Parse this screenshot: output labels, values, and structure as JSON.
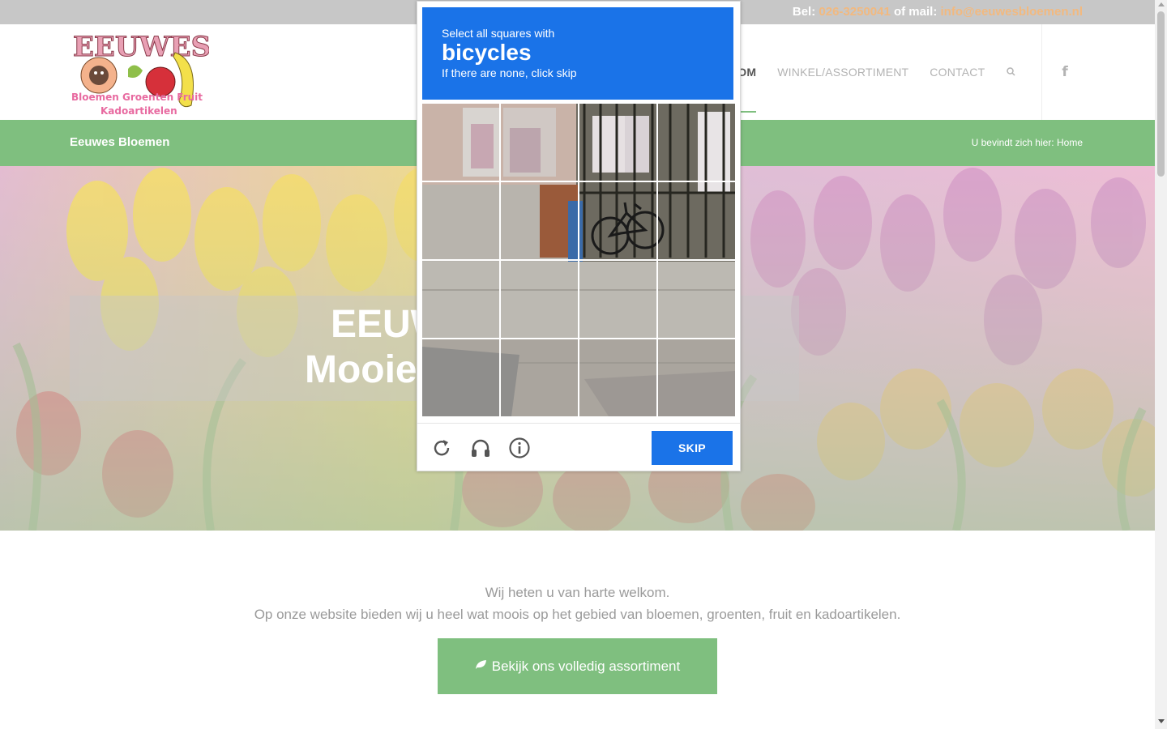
{
  "topbar": {
    "phone_label": "Bel:",
    "phone": "026-3250041",
    "mail_label": "of mail:",
    "email": "info@eeuwesbloemen.nl"
  },
  "header": {
    "logo_text": "EEUWES",
    "logo_tagline": "Bloemen Groenten Fruit",
    "logo_tagline2": "Kadoartikelen",
    "nav": {
      "active_partial": "KOM",
      "shop": "WINKEL/ASSORTIMENT",
      "contact": "CONTACT"
    },
    "facebook_glyph": "f"
  },
  "titlebar": {
    "site_name": "Eeuwes Bloemen",
    "breadcrumb_label": "U bevindt zich hier:",
    "breadcrumb_home": "Home"
  },
  "hero": {
    "line1": "EEUWES B",
    "line2": "Mooie bloeme"
  },
  "welcome": {
    "line1": "Wij heten u van harte welkom.",
    "line2": "Op onze website bieden wij u heel wat moois op het gebied van bloemen, groenten, fruit en kadoartikelen."
  },
  "cta": {
    "label": "Bekijk ons volledig assortiment"
  },
  "captcha": {
    "instruction": "Select all squares with",
    "target": "bicycles",
    "hint": "If there are none, click skip",
    "skip_label": "SKIP",
    "tiles": [
      "1",
      "2",
      "3",
      "4",
      "5",
      "6",
      "7",
      "8",
      "9",
      "10",
      "11",
      "12",
      "13",
      "14",
      "15",
      "16"
    ]
  },
  "colors": {
    "green": "#7fbf7f",
    "blue": "#1a73e8",
    "accent": "#f2b97f"
  }
}
